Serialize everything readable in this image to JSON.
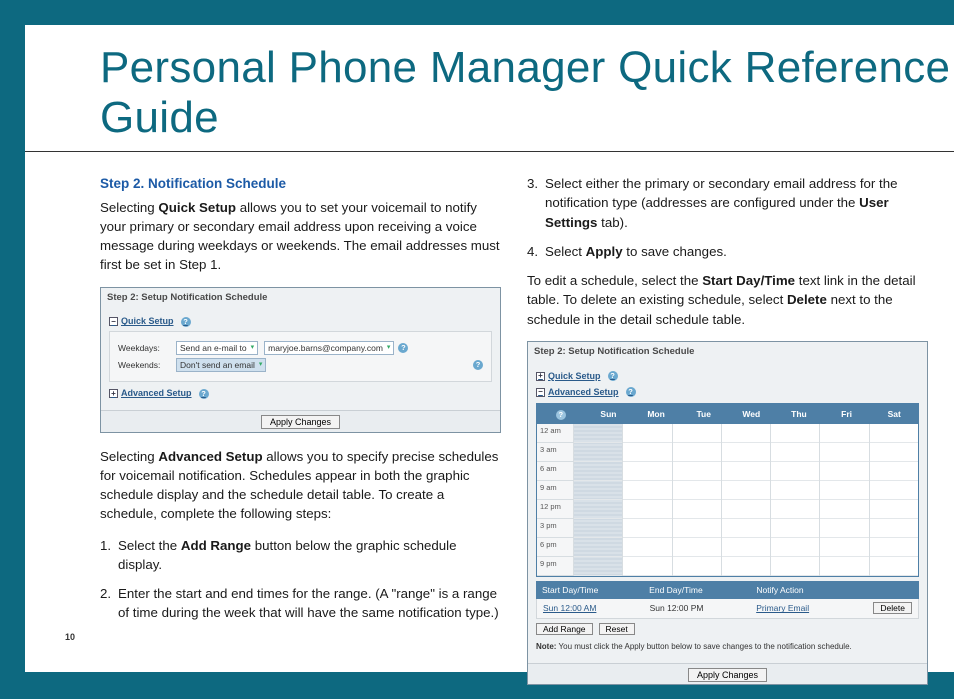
{
  "title": "Personal Phone Manager Quick Reference Guide",
  "page_number": "10",
  "left": {
    "step_heading": "Step 2. Notification Schedule",
    "p1_a": "Selecting ",
    "p1_b": "Quick Setup",
    "p1_c": " allows you to set your voicemail to notify your primary or secondary email address upon receiving a voice message during weekdays or weekends. The email addresses must first be set in Step 1.",
    "p2_a": "Selecting ",
    "p2_b": "Advanced Setup",
    "p2_c": " allows you to specify precise schedules for voicemail notification. Schedules appear in both the graphic schedule display and the schedule detail table. To create a schedule, complete the following steps:",
    "l1_num": "1.",
    "l1_a": "Select the ",
    "l1_b": "Add Range",
    "l1_c": " button below the graphic schedule display.",
    "l2_num": "2.",
    "l2": "Enter the start and end times for the range. (A \"range\" is a range of time during the week that will have the same notification type.)"
  },
  "right": {
    "l3_num": "3.",
    "l3_a": "Select either the primary or secondary email address for the notification type (addresses are configured under the ",
    "l3_b": "User Settings",
    "l3_c": " tab).",
    "l4_num": "4.",
    "l4_a": "Select ",
    "l4_b": "Apply",
    "l4_c": " to save changes.",
    "p3_a": "To edit a schedule, select the ",
    "p3_b": "Start Day/Time",
    "p3_c": " text link in the detail table. To delete an existing schedule, select ",
    "p3_d": "Delete",
    "p3_e": " next to the schedule in the detail schedule table."
  },
  "panel1": {
    "title": "Step 2: Setup Notification Schedule",
    "quick_label": "Quick Setup",
    "weekdays_label": "Weekdays:",
    "weekdays_sel": "Send an e-mail to",
    "weekdays_email": "maryjoe.barns@company.com",
    "weekends_label": "Weekends:",
    "weekends_sel": "Don't send an email",
    "advanced_label": "Advanced Setup",
    "apply": "Apply Changes"
  },
  "panel2": {
    "title": "Step 2: Setup Notification Schedule",
    "quick_label": "Quick Setup",
    "advanced_label": "Advanced Setup",
    "days": [
      "Sun",
      "Mon",
      "Tue",
      "Wed",
      "Thu",
      "Fri",
      "Sat"
    ],
    "times": [
      "12 am",
      "3 am",
      "6 am",
      "9 am",
      "12 pm",
      "3 pm",
      "6 pm",
      "9 pm"
    ],
    "detail_heads": [
      "Start Day/Time",
      "End Day/Time",
      "Notify Action",
      ""
    ],
    "detail_row": [
      "Sun 12:00 AM",
      "Sun 12:00 PM",
      "Primary Email",
      "Delete"
    ],
    "add_range": "Add Range",
    "reset": "Reset",
    "note_a": "Note:",
    "note_b": " You must click the Apply button below to save changes to the notification schedule.",
    "apply": "Apply Changes"
  }
}
